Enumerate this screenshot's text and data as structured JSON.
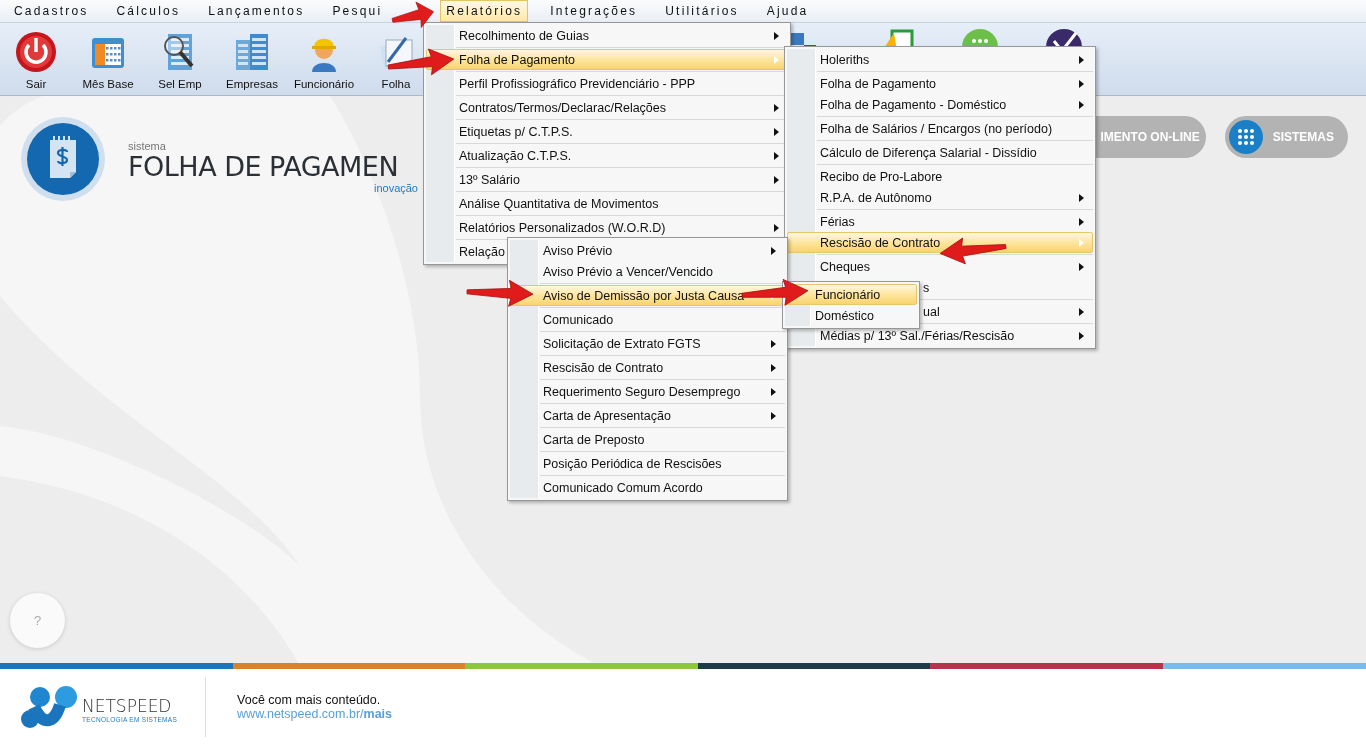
{
  "menubar": [
    {
      "label": "Cadastros",
      "selected": false
    },
    {
      "label": "Cálculos",
      "selected": false
    },
    {
      "label": "Lançamentos",
      "selected": false
    },
    {
      "label": "Pesqui",
      "selected": false
    },
    {
      "label": "Relatórios",
      "selected": true
    },
    {
      "label": "Integrações",
      "selected": false
    },
    {
      "label": "Utilitários",
      "selected": false
    },
    {
      "label": "Ajuda",
      "selected": false
    }
  ],
  "toolbar": [
    {
      "label": "Sair"
    },
    {
      "label": "Mês Base"
    },
    {
      "label": "Sel Emp"
    },
    {
      "label": "Empresas"
    },
    {
      "label": "Funcionário"
    },
    {
      "label": "Folha"
    }
  ],
  "header": {
    "caption": "sistema",
    "title": "FOLHA DE PAGAMEN",
    "tagline": "inovação"
  },
  "header_buttons": [
    {
      "label": "IMENTO ON-LINE"
    },
    {
      "label": "SISTEMAS"
    }
  ],
  "help_button": {
    "label": "?"
  },
  "menus": [
    {
      "groups": [
        [
          {
            "label": "Recolhimento de Guias",
            "submenu": true,
            "selected": false
          }
        ],
        [
          {
            "label": "Folha de Pagamento",
            "submenu": true,
            "selected": true
          }
        ],
        [
          {
            "label": "Perfil Profissiográfico Previdenciário - PPP",
            "submenu": false,
            "selected": false
          }
        ],
        [
          {
            "label": "Contratos/Termos/Declarac/Relações",
            "submenu": true,
            "selected": false
          }
        ],
        [
          {
            "label": "Etiquetas p/ C.T.P.S.",
            "submenu": true,
            "selected": false
          }
        ],
        [
          {
            "label": "Atualização C.T.P.S.",
            "submenu": true,
            "selected": false
          }
        ],
        [
          {
            "label": "13º Salário",
            "submenu": true,
            "selected": false
          }
        ],
        [
          {
            "label": "Análise Quantitativa de Movimentos",
            "submenu": false,
            "selected": false
          }
        ],
        [
          {
            "label": "Relatórios Personalizados (W.O.R.D)",
            "submenu": true,
            "selected": false
          }
        ],
        [
          {
            "label": "Relação",
            "selected": false
          }
        ]
      ]
    },
    {
      "groups": [
        [
          {
            "label": "Holeriths",
            "submenu": true,
            "selected": false,
            "covered": false
          }
        ],
        [
          {
            "label": "Folha de Pagamento",
            "submenu": true,
            "selected": false,
            "covered": false
          },
          {
            "label": "Folha de Pagamento - Doméstico",
            "submenu": true,
            "selected": false,
            "covered": false
          }
        ],
        [
          {
            "label": "Folha de Salários / Encargos (no período)",
            "submenu": false,
            "selected": false,
            "covered": false
          }
        ],
        [
          {
            "label": "Cálculo de Diferença Salarial - Dissídio",
            "submenu": false,
            "selected": false,
            "covered": false
          }
        ],
        [
          {
            "label": "Recibo de Pro-Labore",
            "submenu": false,
            "selected": false,
            "covered": false
          },
          {
            "label": "R.P.A. de Autônomo",
            "submenu": true,
            "selected": false,
            "covered": false
          }
        ],
        [
          {
            "label": "Férias",
            "submenu": true,
            "selected": false,
            "covered": false
          },
          {
            "label": "Rescisão de Contrato",
            "submenu": true,
            "selected": true,
            "covered": false
          }
        ],
        [
          {
            "label": "Cheques",
            "submenu": true,
            "selected": false,
            "covered": false
          },
          {
            "label": "s",
            "submenu": false,
            "selected": false,
            "covered": true
          }
        ],
        [
          {
            "label": "ual",
            "submenu": true,
            "selected": false,
            "covered": true
          }
        ],
        [
          {
            "label": "Médias p/ 13º Sal./Férias/Rescisão",
            "submenu": true,
            "selected": false,
            "covered": false
          }
        ]
      ]
    },
    {
      "groups": [
        [
          {
            "label": "Aviso Prévio",
            "submenu": true,
            "selected": false
          },
          {
            "label": "Aviso Prévio a Vencer/Vencido",
            "submenu": false,
            "selected": false
          }
        ],
        [
          {
            "label": "Aviso de Demissão por Justa Causa",
            "submenu": true,
            "selected": true
          }
        ],
        [
          {
            "label": "Comunicado",
            "submenu": false,
            "selected": false
          }
        ],
        [
          {
            "label": "Solicitação de Extrato FGTS",
            "submenu": true,
            "selected": false
          }
        ],
        [
          {
            "label": "Rescisão de Contrato",
            "submenu": true,
            "selected": false
          }
        ],
        [
          {
            "label": "Requerimento Seguro Desemprego",
            "submenu": true,
            "selected": false
          }
        ],
        [
          {
            "label": "Carta de Apresentação",
            "submenu": true,
            "selected": false
          }
        ],
        [
          {
            "label": "Carta de Preposto",
            "submenu": false,
            "selected": false
          }
        ],
        [
          {
            "label": "Posição Periódica de Rescisões",
            "submenu": false,
            "selected": false
          }
        ],
        [
          {
            "label": "Comunicado Comum Acordo",
            "submenu": false,
            "selected": false
          }
        ]
      ]
    },
    {
      "groups": [
        [
          {
            "label": "Funcionário",
            "submenu": false,
            "selected": true
          },
          {
            "label": "Doméstico",
            "submenu": false,
            "selected": false
          }
        ]
      ]
    }
  ],
  "footer": {
    "brand": "NETSPEED",
    "brand_tagline": "TECNOLOGIA EM SISTEMAS",
    "slogan": "Você com mais conteúdo.",
    "link": "www.netspeed.com.br/**mais**"
  }
}
